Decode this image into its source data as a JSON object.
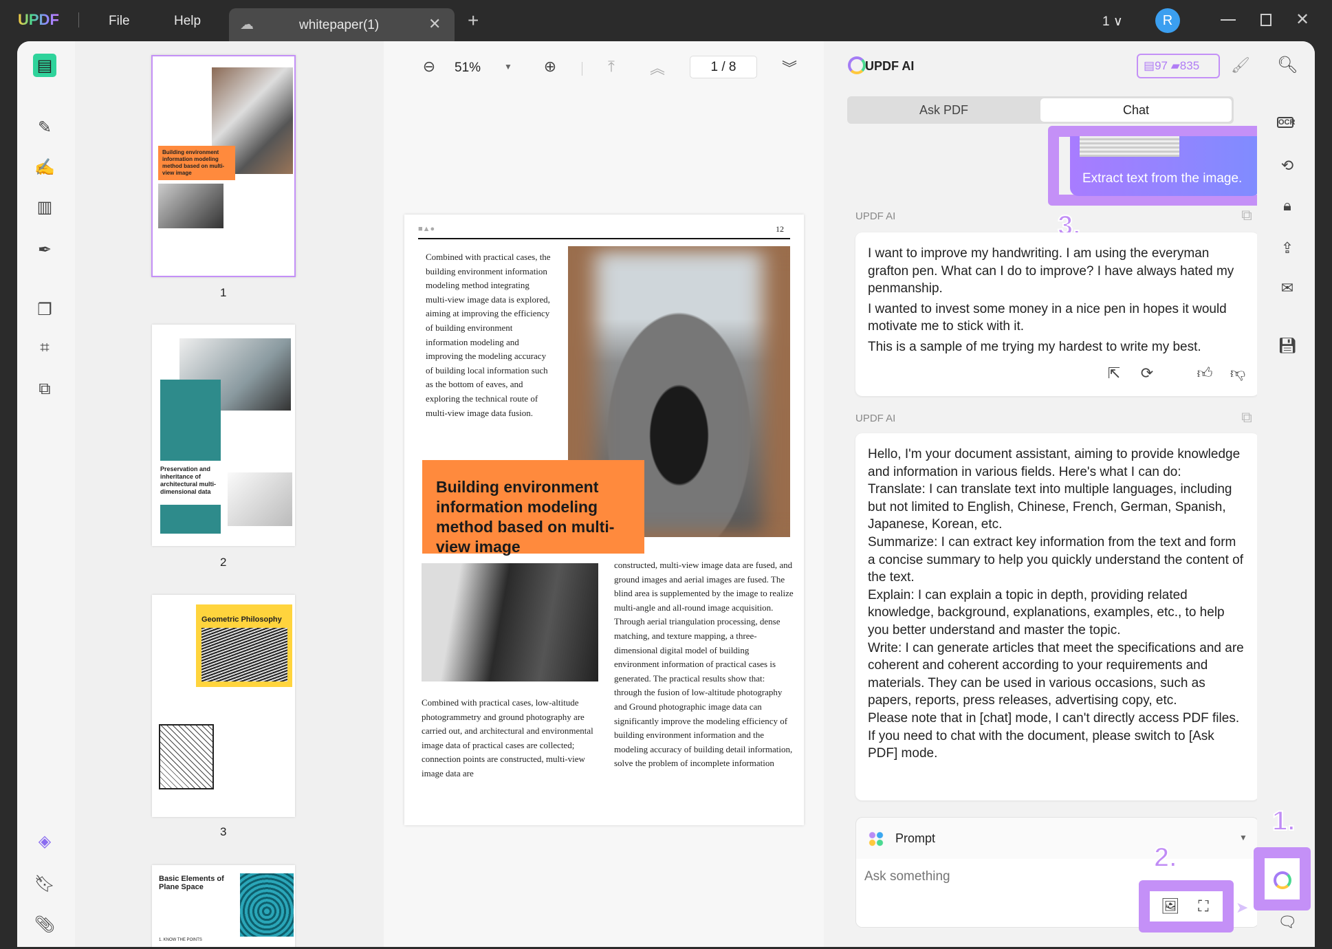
{
  "titlebar": {
    "logo": "UPDF",
    "menu": [
      "File",
      "Help"
    ],
    "tab_title": "whitepaper(1)",
    "window_count": "1",
    "avatar_letter": "R"
  },
  "doc_toolbar": {
    "zoom": "51%",
    "page_current": "1",
    "page_sep": "/",
    "page_total": "8"
  },
  "thumbnails": [
    {
      "label": "1",
      "title": "Building environment information modeling method based on multi-view image"
    },
    {
      "label": "2",
      "title": "Preservation and inheritance of architectural multi-dimensional data"
    },
    {
      "label": "3",
      "title": "Geometric Philosophy"
    },
    {
      "label": "",
      "title": "Basic Elements of Plane Space",
      "sub": "1. KNOW THE POINTS"
    }
  ],
  "page": {
    "number": "12",
    "intro": "Combined with practical cases, the building environment information modeling method integrating multi-view image data is explored, aiming at improving the efficiency of building environment information modeling and improving the modeling accuracy of building local information such as the bottom of eaves, and exploring the technical route of multi-view image data fusion.",
    "headline": "Building environment information modeling method based on multi-view image",
    "col1": "Combined with practical cases, low-altitude photogrammetry and ground photography are carried out, and architectural and environmental image data of practical cases are collected; connection points are constructed, multi-view image data are",
    "col2": "constructed, multi-view image data are fused, and ground images and aerial images are fused. The blind area is supplemented by the image to realize multi-angle and all-round image acquisition. Through aerial triangulation processing, dense matching, and texture mapping, a three-dimensional digital model of building environment information of practical cases is generated. The practical results show that: through the fusion of low-altitude photography and Ground photographic image data can significantly improve the modeling efficiency of building environment information and the modeling accuracy of building detail information, solve the problem of incomplete information"
  },
  "ai": {
    "title": "UPDF AI",
    "credits_a": "97",
    "credits_b": "835",
    "tabs": [
      "Ask PDF",
      "Chat"
    ],
    "active_tab": "Chat",
    "user_message": "Extract text from the image.",
    "sender": "UPDF AI",
    "reply1": [
      "I want to improve my handwriting. I am using the everyman grafton pen. What can I do to improve? I have always hated my penmanship.",
      "I wanted to invest some money in a nice pen in hopes it would motivate me to stick with it.",
      "This is a sample of me trying my hardest to write my best."
    ],
    "reply2": [
      "Hello, I'm your document assistant, aiming to provide knowledge and information in various fields. Here's what I can do:",
      "Translate: I can translate text into multiple languages, including but not limited to English, Chinese, French, German, Spanish, Japanese, Korean, etc.",
      "Summarize: I can extract key information from the text and form a concise summary to help you quickly understand the content of the text.",
      "Explain: I can explain a topic in depth, providing related knowledge, background, explanations, examples, etc., to help you better understand and master the topic.",
      "Write: I can generate articles that meet the specifications and are coherent and coherent according to your requirements and materials. They can be used in various occasions, such as papers, reports, press releases, advertising copy, etc.",
      "Please note that in [chat] mode, I can't directly access PDF files. If you need to chat with the document, please switch to [Ask PDF] mode."
    ],
    "prompt_label": "Prompt",
    "input_placeholder": "Ask something"
  },
  "annotations": [
    "1.",
    "2.",
    "3."
  ],
  "colors": {
    "accent": "#c490f7",
    "orange": "#ff8a3d",
    "teal": "#2e8b8b",
    "bubble_from": "#a87cff",
    "bubble_to": "#7f8cff"
  }
}
